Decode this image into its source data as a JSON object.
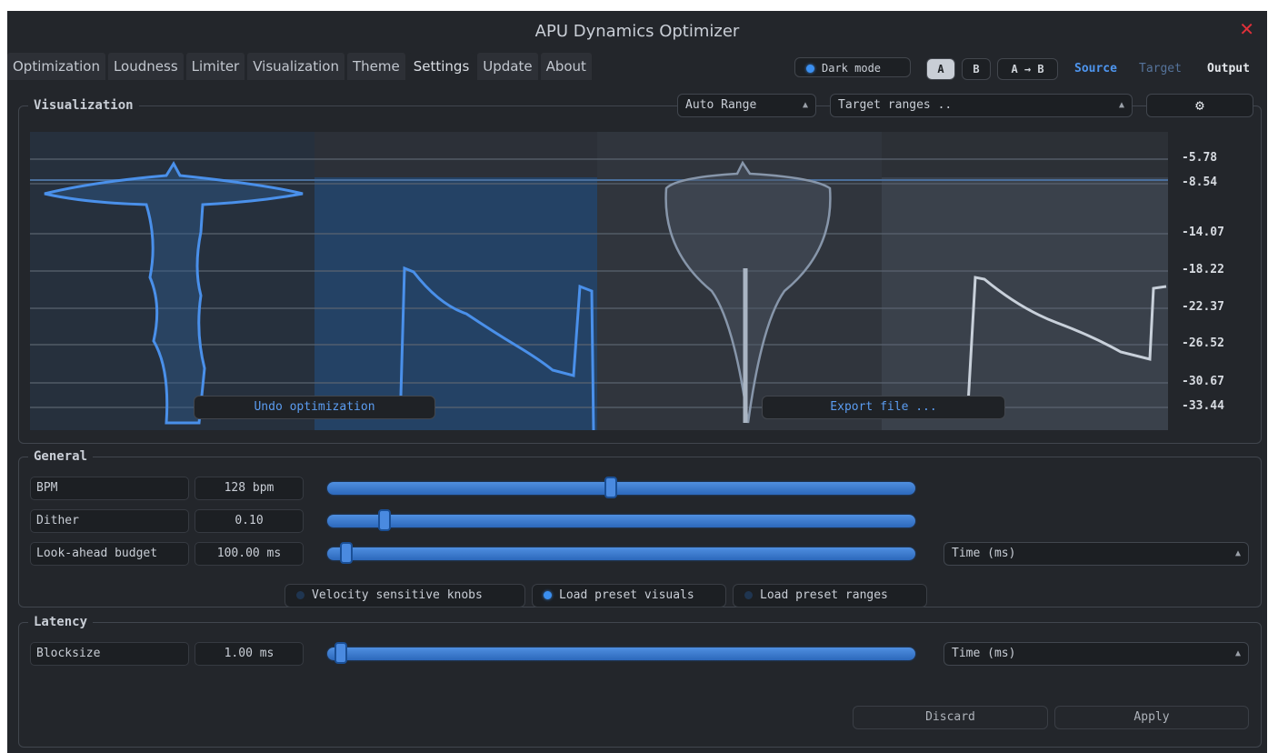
{
  "window": {
    "title": "APU Dynamics Optimizer",
    "close_icon": "close-icon"
  },
  "tabs": [
    {
      "label": "Optimization"
    },
    {
      "label": "Loudness"
    },
    {
      "label": "Limiter"
    },
    {
      "label": "Visualization"
    },
    {
      "label": "Theme"
    },
    {
      "label": "Settings",
      "active": true
    },
    {
      "label": "Update"
    },
    {
      "label": "About"
    }
  ],
  "header": {
    "dark_mode": {
      "label": "Dark mode",
      "on": true
    },
    "ab": [
      {
        "label": "A",
        "active": true
      },
      {
        "label": "B",
        "active": false
      },
      {
        "label": "A → B",
        "active": false
      }
    ],
    "signal": {
      "source": "Source",
      "target": "Target",
      "output": "Output"
    }
  },
  "visualization": {
    "title": "Visualization",
    "range_select": "Auto Range",
    "target_select": "Target ranges ..",
    "settings_icon": "gear-icon",
    "undo_button": "Undo optimization",
    "export_button": "Export file ...",
    "y_labels": [
      "-5.78",
      "-8.54",
      "-14.07",
      "-18.22",
      "-22.37",
      "-26.52",
      "-30.67",
      "-33.44"
    ]
  },
  "general": {
    "title": "General",
    "params": [
      {
        "label": "BPM",
        "value": "128 bpm",
        "position": 0.48
      },
      {
        "label": "Dither",
        "value": "0.10",
        "position": 0.1
      },
      {
        "label": "Look-ahead budget",
        "value": "100.00 ms",
        "position": 0.0,
        "unit_select": "Time (ms)"
      }
    ],
    "toggles": [
      {
        "label": "Velocity sensitive knobs",
        "on": false
      },
      {
        "label": "Load preset visuals",
        "on": true
      },
      {
        "label": "Load preset ranges",
        "on": false
      }
    ]
  },
  "latency": {
    "title": "Latency",
    "params": [
      {
        "label": "Blocksize",
        "value": "1.00 ms",
        "position": 0.0,
        "unit_select": "Time (ms)"
      }
    ]
  },
  "actions": {
    "discard": "Discard",
    "apply": "Apply"
  },
  "colors": {
    "accent": "#3b8ff0",
    "background": "#23262b",
    "close": "#e0303a"
  }
}
